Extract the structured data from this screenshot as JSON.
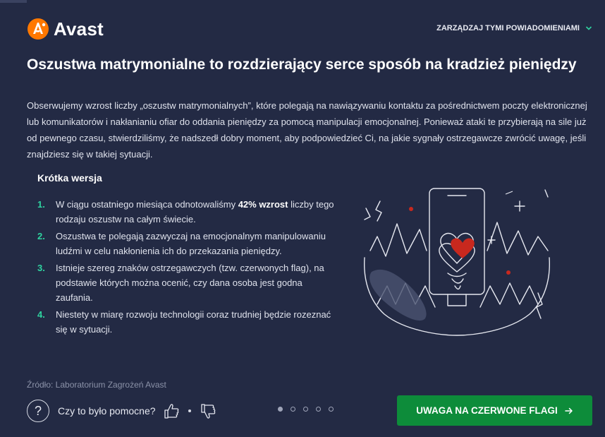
{
  "app": {
    "brand": "Avast",
    "manage_label": "ZARZĄDZAJ TYMI POWIADOMIENIAMI",
    "accent_color": "#2fd3a0",
    "cta_color": "#0d8c3a"
  },
  "article": {
    "title": "Oszustwa matrymonialne to rozdzierający serce sposób na kradzież pieniędzy",
    "intro": "Obserwujemy wzrost liczby „oszustw matrymonialnych”, które polegają na nawiązywaniu kontaktu za pośrednictwem poczty elektronicznej lub komunikatorów i nakłanianiu ofiar do oddania pieniędzy za pomocą manipulacji emocjonalnej. Ponieważ ataki te przybierają na sile już od pewnego czasu, stwierdziliśmy, że nadszedł dobry moment, aby podpowiedzieć Ci, na jakie sygnały ostrzegawcze zwrócić uwagę, jeśli znajdziesz się w takiej sytuacji.",
    "short_title": "Krótka wersja",
    "items": [
      {
        "num": "1.",
        "before": "W ciągu ostatniego miesiąca odnotowaliśmy ",
        "bold": "42% wzrost",
        "after": " liczby tego rodzaju oszustw na całym świecie."
      },
      {
        "num": "2.",
        "text": "Oszustwa te polegają zazwyczaj na emocjonalnym manipulowaniu ludźmi w celu nakłonienia ich do przekazania pieniędzy."
      },
      {
        "num": "3.",
        "text": "Istnieje szereg znaków ostrzegawczych (tzw. czerwonych flag), na podstawie których można ocenić, czy dana osoba jest godna zaufania."
      },
      {
        "num": "4.",
        "text": "Niestety w miarę rozwoju technologii coraz trudniej będzie rozeznać się w sytuacji."
      }
    ],
    "source": "Źródło: Laboratorium Zagrożeń Avast"
  },
  "footer": {
    "help_icon": "question-circle-icon",
    "help_text": "Czy to było pomocne?",
    "thumbs_up_icon": "thumbs-up-icon",
    "thumbs_down_icon": "thumbs-down-icon",
    "pagination": {
      "total": 5,
      "current": 1
    },
    "cta_label": "UWAGA NA CZERWONE FLAGI"
  }
}
